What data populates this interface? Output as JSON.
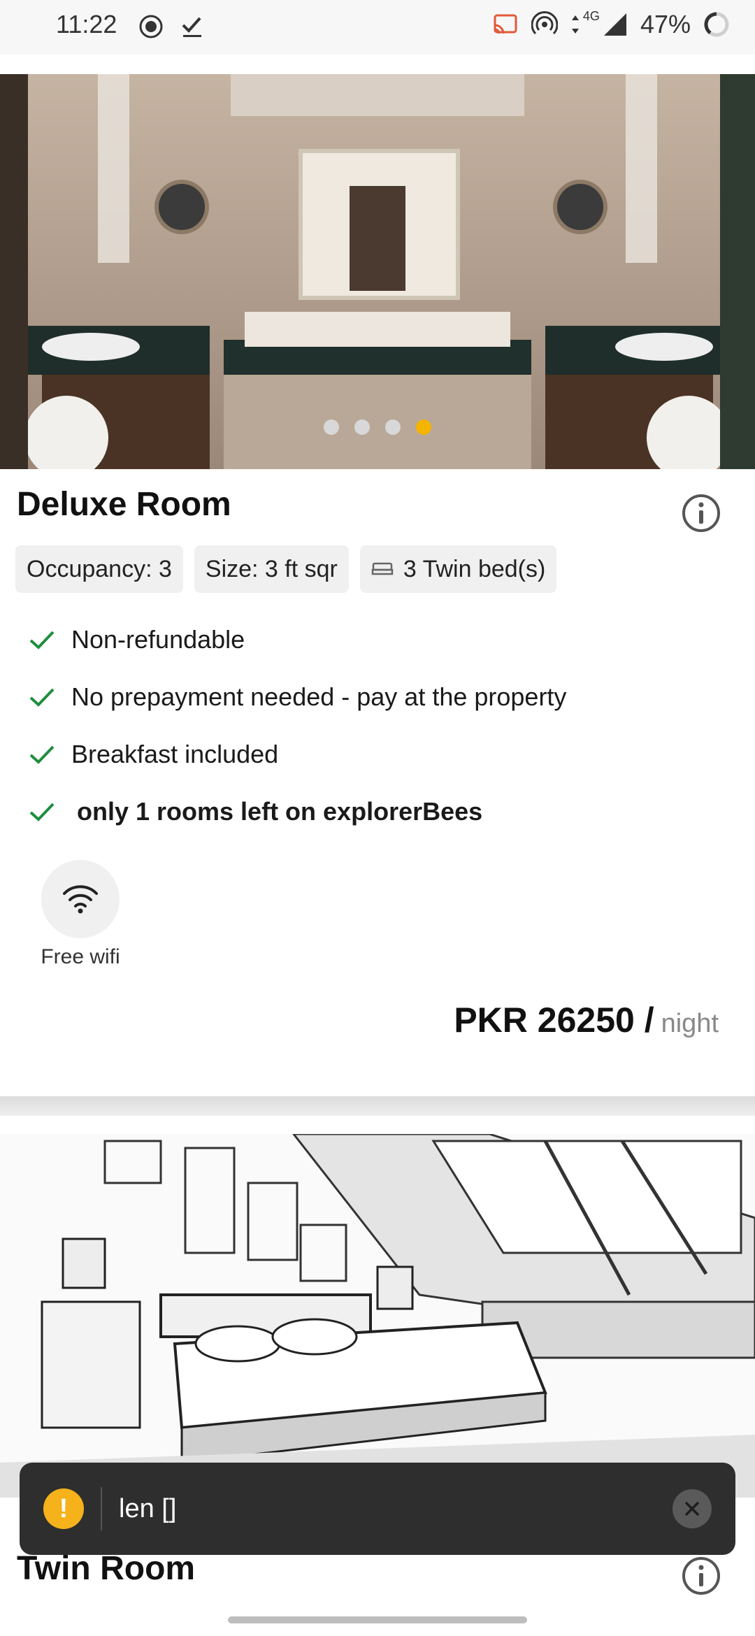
{
  "status_bar": {
    "time": "11:22",
    "network": "4G",
    "battery": "47%"
  },
  "carousel": {
    "dots": 4,
    "active_index": 3
  },
  "room1": {
    "title": "Deluxe Room",
    "chips": {
      "occupancy": "Occupancy: 3",
      "size": "Size: 3 ft sqr",
      "beds": "3 Twin bed(s)"
    },
    "features": [
      "Non-refundable",
      "No prepayment needed - pay at the property",
      "Breakfast included",
      "only 1 rooms left on explorerBees"
    ],
    "amenity": {
      "icon": "wifi-icon",
      "label": "Free wifi"
    },
    "price": {
      "amount": "PKR 26250 /",
      "unit": "night"
    }
  },
  "room2": {
    "title": "Twin Room"
  },
  "snackbar": {
    "icon": "warning-icon",
    "message": "len []"
  },
  "colors": {
    "accent": "#f5b400",
    "check": "#1e8e3e",
    "snackbar_bg": "#2e2e2e"
  }
}
